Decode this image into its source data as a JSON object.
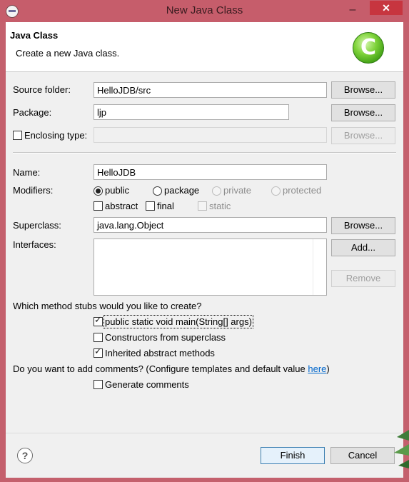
{
  "window": {
    "title": "New Java Class"
  },
  "header": {
    "title": "Java Class",
    "description": "Create a new Java class.",
    "icon_letter": "C"
  },
  "colors": {
    "frame": "#c65d6b",
    "close": "#c7353f",
    "link": "#0066cc"
  },
  "form": {
    "source_folder": {
      "label": "Source folder:",
      "value": "HelloJDB/src",
      "button": "Browse..."
    },
    "package": {
      "label": "Package:",
      "value": "ljp",
      "button": "Browse..."
    },
    "enclosing_type": {
      "label": "Enclosing type:",
      "value": "",
      "button": "Browse...",
      "checked": false
    },
    "name": {
      "label": "Name:",
      "value": "HelloJDB"
    },
    "modifiers": {
      "label": "Modifiers:",
      "public": "public",
      "package": "package",
      "private": "private",
      "protected": "protected",
      "abstract": "abstract",
      "final": "final",
      "static": "static",
      "selected": "public"
    },
    "superclass": {
      "label": "Superclass:",
      "value": "java.lang.Object",
      "button": "Browse..."
    },
    "interfaces": {
      "label": "Interfaces:",
      "add": "Add...",
      "remove": "Remove"
    },
    "stubs": {
      "question": "Which method stubs would you like to create?",
      "main": "public static void main(String[] args)",
      "constructors": "Constructors from superclass",
      "inherited": "Inherited abstract methods"
    },
    "comments": {
      "question": "Do you want to add comments? (Configure templates and default value ",
      "link": "here",
      "tail": ")",
      "generate": "Generate comments"
    }
  },
  "footer": {
    "finish": "Finish",
    "cancel": "Cancel",
    "help_icon": "help-icon"
  }
}
